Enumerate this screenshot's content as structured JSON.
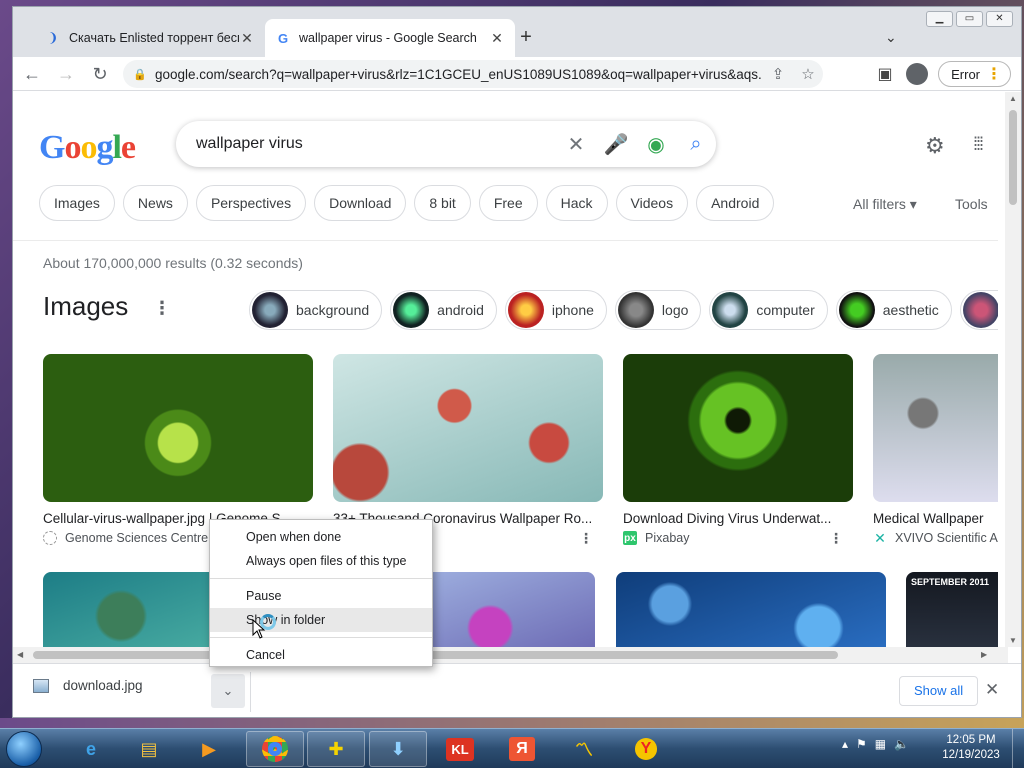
{
  "browser": {
    "tabs": [
      {
        "title": "Скачать Enlisted торрент беспла",
        "active": false
      },
      {
        "title": "wallpaper virus - Google Search",
        "active": true
      }
    ],
    "url": "google.com/search?q=wallpaper+virus&rlz=1C1GCEU_enUS1089US1089&oq=wallpaper+virus&aqs...",
    "error_button": "Error"
  },
  "google": {
    "logo_letters": [
      "G",
      "o",
      "o",
      "g",
      "l",
      "e"
    ],
    "query": "wallpaper virus",
    "chips": [
      "Images",
      "News",
      "Perspectives",
      "Download",
      "8 bit",
      "Free",
      "Hack",
      "Videos",
      "Android"
    ],
    "all_filters": "All filters",
    "tools": "Tools",
    "stats": "About 170,000,000 results (0.32 seconds)",
    "images_heading": "Images",
    "refine_chips": [
      "background",
      "android",
      "iphone",
      "logo",
      "computer",
      "aesthetic"
    ],
    "image_results": [
      {
        "title": "Cellular-virus-wallpaper.jpg | Genome S...",
        "source": "Genome Sciences Centre"
      },
      {
        "title": "33+ Thousand Coronavirus Wallpaper Ro...",
        "source": ""
      },
      {
        "title": "Download Diving Virus Underwat...",
        "source": "Pixabay"
      },
      {
        "title": "Medical Wallpaper",
        "source": "XVIVO Scientific A"
      }
    ],
    "second_row_caption": "SEPTEMBER 2011"
  },
  "download_shelf": {
    "filename": "download.jpg",
    "show_all": "Show all"
  },
  "context_menu": {
    "items": [
      "Open when done",
      "Always open files of this type",
      "Pause",
      "Show in folder",
      "Cancel"
    ],
    "hovered": "Show in folder"
  },
  "taskbar": {
    "time": "12:05 PM",
    "date": "12/19/2023"
  },
  "colors": {
    "accent": "#1a73e8",
    "taskbar": "#2d4e72"
  }
}
